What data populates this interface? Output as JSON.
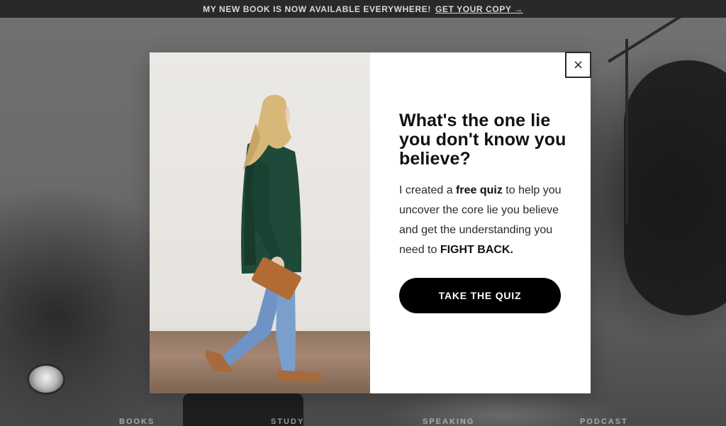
{
  "announcement": {
    "message": "MY NEW BOOK IS NOW AVAILABLE EVERYWHERE!",
    "link_label": "GET YOUR COPY →"
  },
  "modal": {
    "title": "What's the one lie you don't know you believe?",
    "body_part1": "I created a ",
    "body_bold1": "free quiz",
    "body_part2": " to help you uncover the core lie you believe and get the understanding you need to ",
    "body_bold2": "FIGHT BACK.",
    "cta_label": "TAKE THE QUIZ",
    "close_symbol": "×",
    "close_icon": "close-icon",
    "photo_icon": "woman-walking-photo"
  },
  "background_nav": {
    "items": [
      "BOOKS",
      "STUDY",
      "SPEAKING",
      "PODCAST"
    ]
  },
  "colors": {
    "topbar_bg": "#2b2829",
    "cta_bg": "#000000",
    "overlay": "#6b6b6b"
  }
}
